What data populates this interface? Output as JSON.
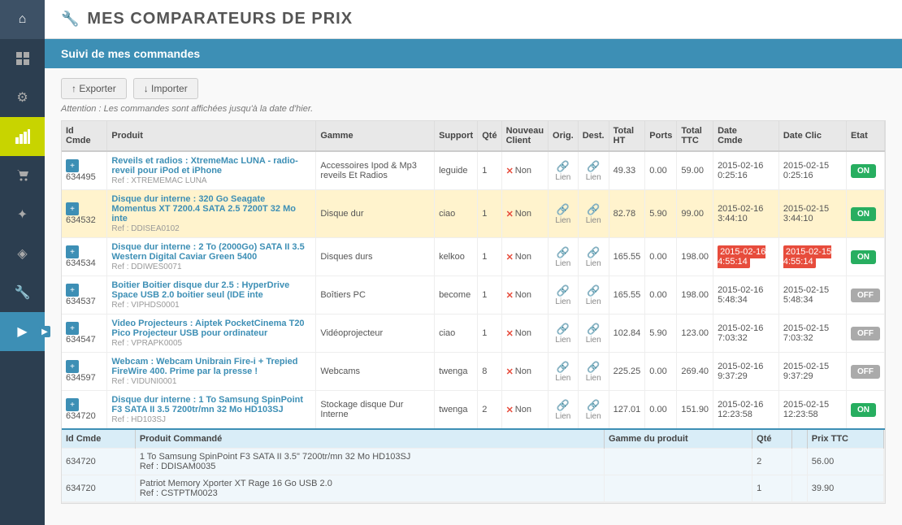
{
  "sidebar": {
    "items": [
      {
        "id": "home",
        "icon": "⌂",
        "active": false
      },
      {
        "id": "dashboard",
        "icon": "⊞",
        "active": false
      },
      {
        "id": "settings",
        "icon": "⚙",
        "active": false
      },
      {
        "id": "chart",
        "icon": "▦",
        "active": true
      },
      {
        "id": "cart",
        "icon": "🛒",
        "active": false
      },
      {
        "id": "users",
        "icon": "✦",
        "active": false
      },
      {
        "id": "tags",
        "icon": "◈",
        "active": false
      },
      {
        "id": "tools",
        "icon": "🔧",
        "active": false
      },
      {
        "id": "arrow",
        "icon": "▶",
        "active": false,
        "selected": true
      }
    ]
  },
  "page": {
    "title": "MES COMPARATEURS DE PRIX",
    "icon": "🔧",
    "section_title": "Suivi de mes commandes"
  },
  "toolbar": {
    "export_label": "↑ Exporter",
    "import_label": "↓ Importer"
  },
  "notice": "Attention : Les commandes sont affichées jusqu'à la date d'hier.",
  "table": {
    "headers": [
      "Id Cmde",
      "Produit",
      "Gamme",
      "Support",
      "Qté",
      "Nouveau Client",
      "Orig.",
      "Dest.",
      "Total HT",
      "Ports",
      "Total TTC",
      "Date Cmde",
      "Date Clic",
      "Etat"
    ],
    "rows": [
      {
        "id": "634495",
        "produit": "Reveils et radios : XtremeMac LUNA - radio-reveil pour iPod et iPhone",
        "ref": "Ref : XTREMEMAC LUNA",
        "gamme": "Accessoires Ipod & Mp3 reveils Et Radios",
        "support": "leguide",
        "qte": "1",
        "nouveau_client": "Non",
        "total_ht": "49.33",
        "ports": "0.00",
        "total_ttc": "59.00",
        "date_cmde": "2015-02-16 0:25:16",
        "date_clic": "2015-02-15 0:25:16",
        "etat": "ON",
        "expanded": false,
        "highlighted": false
      },
      {
        "id": "634532",
        "produit": "Disque dur interne : 320 Go Seagate Momentus XT 7200.4 SATA 2.5 7200T 32 Mo inte",
        "ref": "Ref : DDISEA0102",
        "gamme": "Disque dur",
        "support": "ciao",
        "qte": "1",
        "nouveau_client": "Non",
        "total_ht": "82.78",
        "ports": "5.90",
        "total_ttc": "99.00",
        "date_cmde": "2015-02-16 3:44:10",
        "date_clic": "2015-02-15 3:44:10",
        "etat": "ON",
        "expanded": false,
        "highlighted": true
      },
      {
        "id": "634534",
        "produit": "Disque dur interne : 2 To (2000Go) SATA II 3.5 Western Digital Caviar Green 5400",
        "ref": "Ref : DDIWES0071",
        "gamme": "Disques durs",
        "support": "kelkoo",
        "qte": "1",
        "nouveau_client": "Non",
        "total_ht": "165.55",
        "ports": "0.00",
        "total_ttc": "198.00",
        "date_cmde": "2015-02-16 4:55:14",
        "date_clic": "2015-02-15 4:55:14",
        "etat": "ON",
        "date_highlight": true,
        "expanded": false,
        "highlighted": false
      },
      {
        "id": "634537",
        "produit": "Boitier Boitier disque dur 2.5 : HyperDrive Space USB 2.0 boitier seul (IDE inte",
        "ref": "Ref : VIPHDS0001",
        "gamme": "Boîtiers PC",
        "support": "become",
        "qte": "1",
        "nouveau_client": "Non",
        "total_ht": "165.55",
        "ports": "0.00",
        "total_ttc": "198.00",
        "date_cmde": "2015-02-16 5:48:34",
        "date_clic": "2015-02-15 5:48:34",
        "etat": "OFF",
        "expanded": false,
        "highlighted": false
      },
      {
        "id": "634547",
        "produit": "Video Projecteurs : Aiptek PocketCinema T20 Pico Projecteur USB pour ordinateur",
        "ref": "Ref : VPRAPK0005",
        "gamme": "Vidéoprojecteur",
        "support": "ciao",
        "qte": "1",
        "nouveau_client": "Non",
        "total_ht": "102.84",
        "ports": "5.90",
        "total_ttc": "123.00",
        "date_cmde": "2015-02-16 7:03:32",
        "date_clic": "2015-02-15 7:03:32",
        "etat": "OFF",
        "expanded": false,
        "highlighted": false
      },
      {
        "id": "634597",
        "produit": "Webcam : Webcam Unibrain Fire-i + Trepied FireWire 400. Prime par la presse !",
        "ref": "Ref : VIDUNI0001",
        "gamme": "Webcams",
        "support": "twenga",
        "qte": "8",
        "nouveau_client": "Non",
        "total_ht": "225.25",
        "ports": "0.00",
        "total_ttc": "269.40",
        "date_cmde": "2015-02-16 9:37:29",
        "date_clic": "2015-02-15 9:37:29",
        "etat": "OFF",
        "expanded": false,
        "highlighted": false
      },
      {
        "id": "634720",
        "produit": "Disque dur interne : 1 To Samsung SpinPoint F3 SATA II 3.5 7200tr/mn 32 Mo HD103SJ",
        "ref": "Ref : HD103SJ",
        "gamme": "Stockage disque Dur Interne",
        "support": "twenga",
        "qte": "2",
        "nouveau_client": "Non",
        "total_ht": "127.01",
        "ports": "0.00",
        "total_ttc": "151.90",
        "date_cmde": "2015-02-16 12:23:58",
        "date_clic": "2015-02-15 12:23:58",
        "etat": "ON",
        "expanded": true,
        "highlighted": false
      }
    ],
    "sub_table": {
      "headers": [
        "Id Cmde",
        "Produit Commandé",
        "Gamme du produit",
        "Qté",
        "",
        "Prix TTC"
      ],
      "rows": [
        {
          "id": "634720",
          "produit": "1 To Samsung SpinPoint F3 SATA II 3.5\" 7200tr/mn 32 Mo HD103SJ\nRef : DDISAM0035",
          "gamme": "",
          "qte": "2",
          "prix": "56.00"
        },
        {
          "id": "634720",
          "produit": "Patriot Memory Xporter XT Rage 16 Go USB 2.0\nRef : CSTPTM0023",
          "gamme": "",
          "qte": "1",
          "prix": "39.90"
        }
      ]
    }
  }
}
